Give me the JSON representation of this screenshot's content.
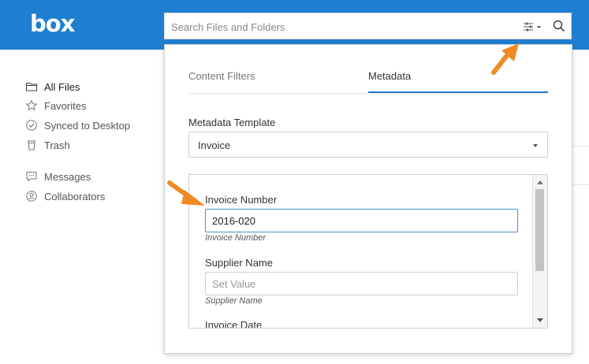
{
  "app": {
    "logo_text": "box",
    "brand_color": "#1e7fd1",
    "accent_color": "#2a7ac8",
    "arrow_color": "#f08a24"
  },
  "search": {
    "placeholder": "Search Files and Folders",
    "value": ""
  },
  "icons": {
    "filter": "sliders-filter-icon",
    "search": "magnifier-search-icon"
  },
  "sidebar": {
    "items": [
      {
        "label": "All Files",
        "icon": "folder-icon"
      },
      {
        "label": "Favorites",
        "icon": "star-icon"
      },
      {
        "label": "Synced to Desktop",
        "icon": "check-circle-icon"
      },
      {
        "label": "Trash",
        "icon": "trash-icon"
      },
      {
        "label": "Messages",
        "icon": "message-icon"
      },
      {
        "label": "Collaborators",
        "icon": "person-circle-icon"
      }
    ]
  },
  "filter_panel": {
    "tabs": [
      {
        "label": "Content Filters"
      },
      {
        "label": "Metadata"
      }
    ],
    "active_tab": "Metadata",
    "template_label": "Metadata Template",
    "template_value": "Invoice",
    "fields": [
      {
        "label": "Invoice Number",
        "value": "2016-020",
        "placeholder": "",
        "hint": "Invoice Number"
      },
      {
        "label": "Supplier Name",
        "value": "",
        "placeholder": "Set Value",
        "hint": "Supplier Name"
      },
      {
        "label": "Invoice Date"
      }
    ]
  }
}
